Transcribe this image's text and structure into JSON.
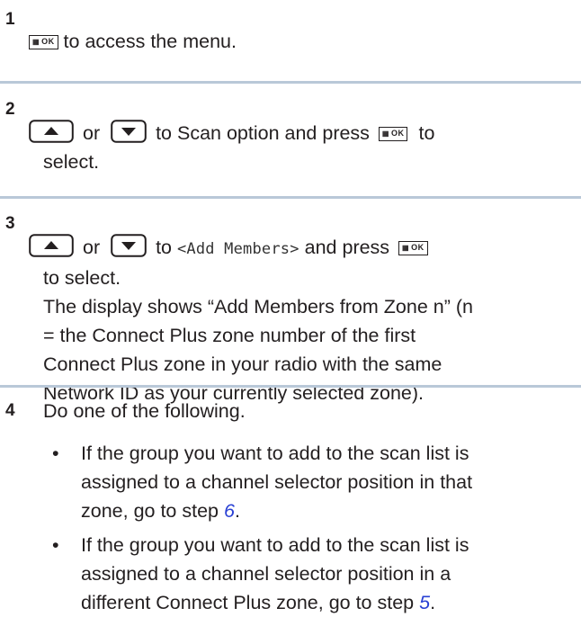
{
  "keys": {
    "ok_label": "OK",
    "grid_glyph": "▦"
  },
  "step1": {
    "number": "1",
    "text": "to access the menu."
  },
  "step2": {
    "number": "2",
    "or": "or",
    "text_a": "to Scan option and press",
    "text_b": "to",
    "text_c": "select."
  },
  "step3": {
    "number": "3",
    "or": "or",
    "to": "to",
    "menu_item": "<Add Members>",
    "and_press": "and press",
    "text_select": "to select.",
    "desc_lines": [
      "The display shows “Add Members from Zone n” (n",
      "= the Connect Plus zone number of the first",
      "Connect Plus zone in your radio with the same",
      "Network ID as your currently selected zone)."
    ]
  },
  "step4": {
    "number": "4",
    "intro": "Do one of the following.",
    "bullet_char": "•",
    "bullets": [
      {
        "lines": [
          "If the group you want to add to the scan list is",
          "assigned to a channel selector position in that"
        ],
        "last_prefix": "zone, go to step ",
        "step_ref": "6",
        "last_suffix": "."
      },
      {
        "lines": [
          "If the group you want to add to the scan list is",
          "assigned to a channel selector position in a"
        ],
        "last_prefix": "different Connect Plus zone, go to step ",
        "step_ref": "5",
        "last_suffix": "."
      }
    ]
  }
}
